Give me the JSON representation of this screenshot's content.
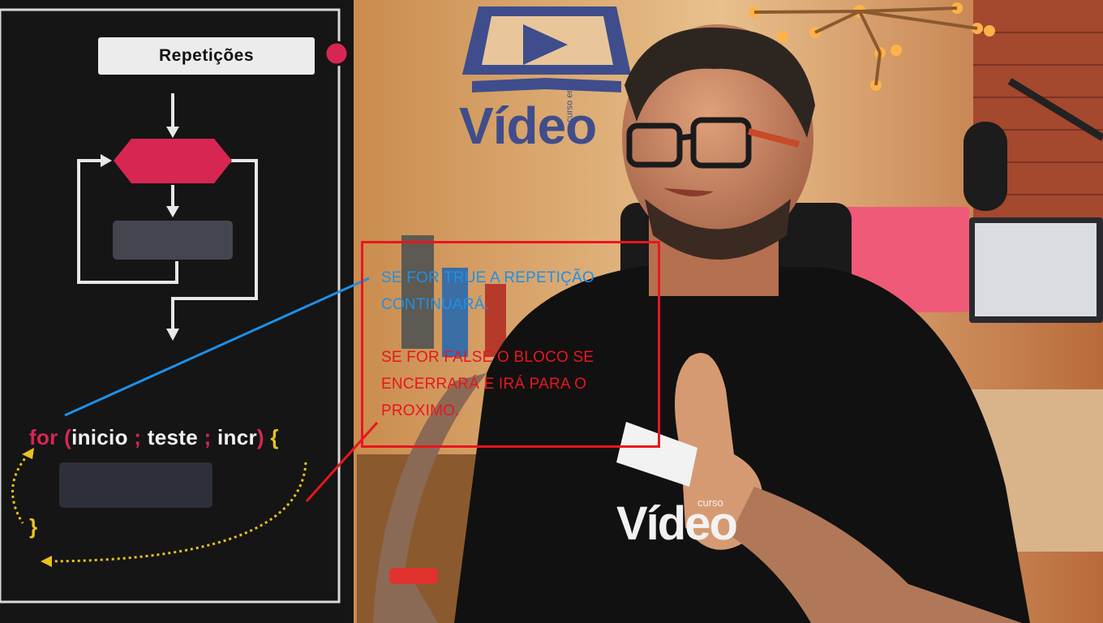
{
  "panel": {
    "title": "Repetições",
    "code": {
      "keyword": "for",
      "open_paren": "(",
      "init": "inicio",
      "sep1": ";",
      "test": "teste",
      "sep2": ";",
      "incr": "incr",
      "close_paren": ")",
      "open_brace": "{",
      "close_brace": "}"
    }
  },
  "annotation": {
    "true_note": "SE FOR TRUE A REPETIÇÃO CONTINUARÁ.",
    "false_note": "SE FOR FALSE O BLOCO SE ENCERRARÁ E IRÁ PARA O PROXIMO."
  },
  "background": {
    "wall_logo_small": "curso em",
    "wall_logo": "Vídeo",
    "shirt_logo_small": "curso",
    "shirt_logo": "Vídeo"
  },
  "colors": {
    "panel_bg": "#151515",
    "accent_red": "#d72652",
    "accent_yellow": "#e9c21e",
    "note_blue": "#1e90e8",
    "note_red": "#e8161e"
  }
}
